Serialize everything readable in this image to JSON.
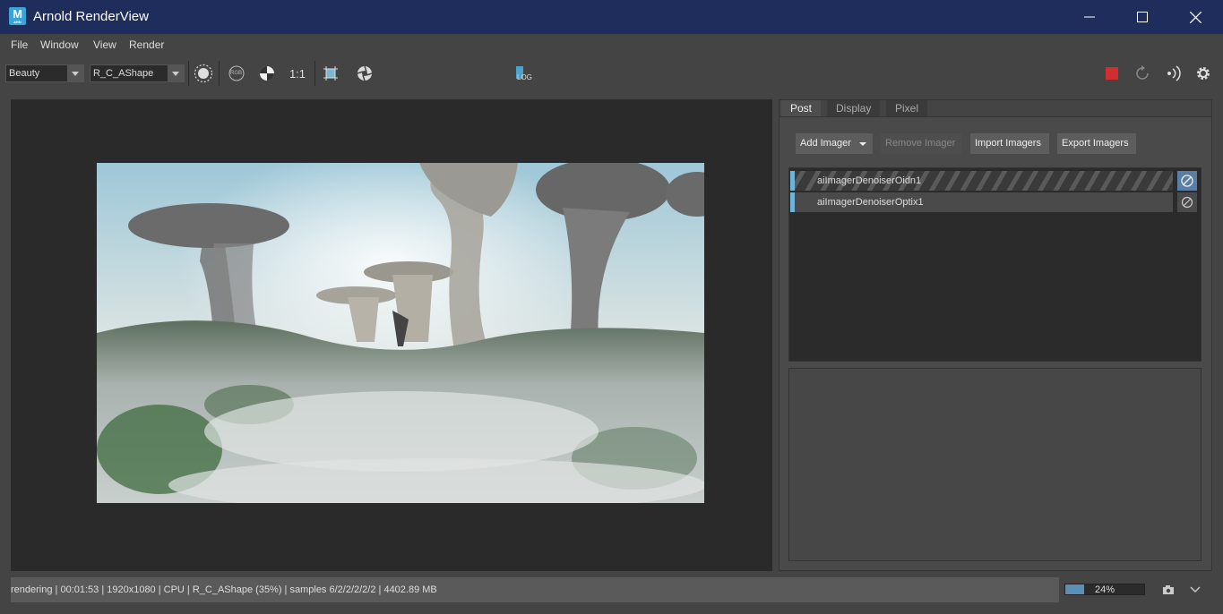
{
  "window": {
    "title": "Arnold RenderView",
    "app_icon_letter": "M",
    "app_icon_sub": "ARN"
  },
  "menu": {
    "items": [
      "File",
      "Window",
      "View",
      "Render"
    ]
  },
  "toolbar": {
    "aov_combo": "Beauty",
    "camera_combo": "R_C_AShape",
    "rgb_label": "RGB",
    "ratio_label": "1:1",
    "exposure_value": "0",
    "exposure_level": 0.5,
    "log_label": "LOG"
  },
  "tabs": [
    "Post",
    "Display",
    "Pixel"
  ],
  "imager_buttons": {
    "add": "Add Imager",
    "remove": "Remove Imager",
    "import": "Import Imagers",
    "export": "Export Imagers"
  },
  "imagers": [
    {
      "name": "aiImagerDenoiserOidn1"
    },
    {
      "name": "aiImagerDenoiserOptix1"
    }
  ],
  "status": {
    "text": "rendering | 00:01:53 | 1920x1080 | CPU | R_C_AShape (35%) | samples 6/2/2/2/2/2 | 4402.89 MB",
    "progress_label": "24%",
    "progress_fraction": 0.24
  },
  "colors": {
    "titlebar": "#1e2d5c",
    "accent": "#6fb4d8",
    "stop": "#d12f2f"
  }
}
